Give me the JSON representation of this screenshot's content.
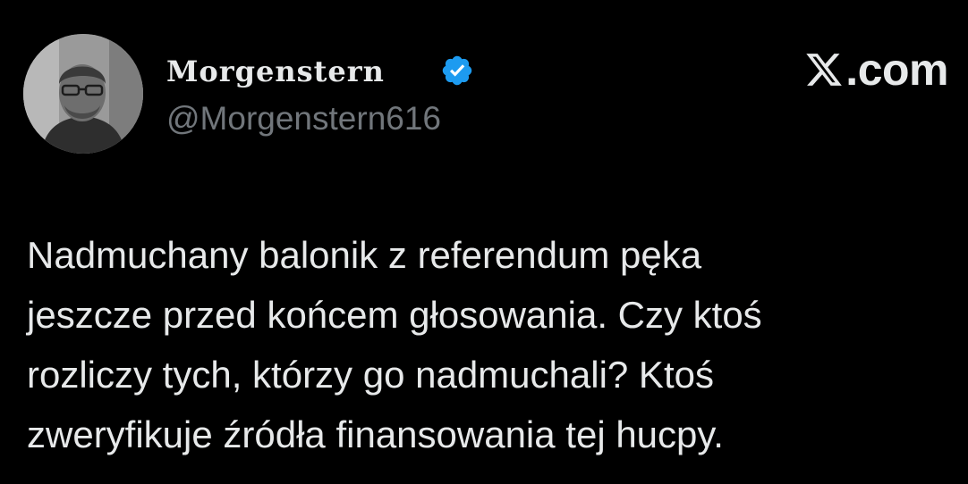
{
  "author": {
    "display_name": "Morgenstern",
    "handle": "@Morgenstern616",
    "verified_icon": "verified-badge-icon",
    "verified_color": "#1d9bf0"
  },
  "brand": {
    "text": ".com",
    "icon": "x-logo-icon"
  },
  "tweet": {
    "lines": [
      "Nadmuchany balonik z referendum pęka",
      "jeszcze przed końcem głosowania. Czy ktoś",
      "rozliczy tych, którzy go nadmuchali? Ktoś",
      "zweryfikuje źródła finansowania tej hucpy."
    ]
  },
  "colors": {
    "background": "#000000",
    "text_primary": "#e7e9ea",
    "text_secondary": "#71767b"
  }
}
